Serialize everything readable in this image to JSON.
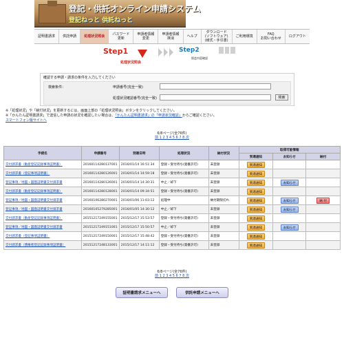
{
  "header": {
    "title": "登記・供託オンライン申請システム",
    "subtitle": "登記ねっと 供託ねっと"
  },
  "nav": [
    {
      "label": "証明書請求"
    },
    {
      "label": "供託申請"
    },
    {
      "label": "処理状況照会",
      "active": true
    },
    {
      "label": "パスワード\n更新"
    },
    {
      "label": "申請者情報\n変更"
    },
    {
      "label": "申請者情報\n抹消"
    },
    {
      "label": "ヘルプ"
    },
    {
      "label": "ダウンロード\n(ソフトウェア)\n(様式・手引書)"
    },
    {
      "label": "ご利用環境"
    },
    {
      "label": "FAQ\nお問い合わせ"
    },
    {
      "label": "ログアウト"
    }
  ],
  "steps": {
    "step1": "Step1",
    "step1_label": "処理状況照会",
    "step2": "Step2",
    "step2_label": "照会内容確認"
  },
  "search": {
    "caption": "確認する申請・請求の条件を入力してください",
    "condition_label": "検索条件：",
    "field1_label": "申請番号(完全一致)",
    "field2_label": "処理状況確認番号(完全一致)",
    "field1_value": "",
    "field2_value": "",
    "button": "検索"
  },
  "notes": {
    "line1": "※「処理状況」や「納付状況」を更新するには、画面上部の「処理状況照会」ボタンをクリックしてください。",
    "line2_pre": "※「かんたん証明書請求」で送信した申請の状況を確認したい場合は、",
    "line2_link1": "「かんたん証明書請求」の「申請状況確認」",
    "line2_post": "からご確認ください。",
    "line3": "スマートフォン版サイトへ"
  },
  "pager": {
    "summary": "6/8ページ(全76件)",
    "links": "前 1 2 3 4 5 6 7 8 次"
  },
  "table": {
    "headers": {
      "name": "手続名",
      "number": "申請番号",
      "date": "到達日時",
      "status": "処理状況",
      "payment": "納付状況",
      "info": "取得可能情報",
      "arrival": "到達通知",
      "notice": "お知らせ",
      "pay": "納付"
    },
    "rows": [
      {
        "name": "交付請求書（動産登記記録事項証明書）",
        "number": "20160114280137001",
        "date": "2016/01/14 16:51:34",
        "status": "登録・受付待ち(発番許可)",
        "payment": "未登録",
        "arrival": "到達通知",
        "notice": "",
        "pay": ""
      },
      {
        "name": "交付請求書（登記事項証明書）",
        "number": "20160114280126001",
        "date": "2016/01/14 14:59:18",
        "status": "登録・受付待ち(発番許可)",
        "payment": "未登録",
        "arrival": "到達通知",
        "notice": "",
        "pay": ""
      },
      {
        "name": "登記事項／地図・図面証明書交付請求書",
        "number": "20160114280126001",
        "date": "2016/01/14 14:30:31",
        "status": "中止／却下",
        "payment": "未登録",
        "arrival": "到達通知",
        "notice": "お知らせ",
        "pay": ""
      },
      {
        "name": "交付請求書（動産登記記録事項証明書）",
        "number": "20160114280128001",
        "date": "2016/01/14 09:34:51",
        "status": "登録・受付待ち(発番許可)",
        "payment": "未登録",
        "arrival": "到達通知",
        "notice": "",
        "pay": ""
      },
      {
        "name": "登記事項／地図・図面証明書交付請求書",
        "number": "20160106280270001",
        "date": "2016/01/06 11:03:12",
        "status": "処理中",
        "payment": "納付期限切れ",
        "arrival": "到達通知",
        "notice": "お知らせ",
        "pay": "納 付"
      },
      {
        "name": "登記事項／地図・図面証明書交付請求書",
        "number": "20160105279285001",
        "date": "2016/01/05 14:30:12",
        "status": "中止／却下",
        "payment": "未登録",
        "arrival": "到達通知",
        "notice": "お知らせ",
        "pay": ""
      },
      {
        "name": "交付請求書（動産登記記録事項証明書）",
        "number": "20151217249155001",
        "date": "2015/12/17 15:53:57",
        "status": "登録・受付待ち(発番許可)",
        "payment": "未登録",
        "arrival": "到達通知",
        "notice": "",
        "pay": ""
      },
      {
        "name": "登記事項／地図・図面証明書交付請求書",
        "number": "20151217249151001",
        "date": "2015/12/17 15:50:57",
        "status": "中止／却下",
        "payment": "未登録",
        "arrival": "到達通知",
        "notice": "お知らせ",
        "pay": ""
      },
      {
        "name": "交付請求書（登記事項証明書）",
        "number": "20151217249150001",
        "date": "2015/12/17 15:48:42",
        "status": "登録・受付待ち(発番許可)",
        "payment": "未登録",
        "arrival": "到達通知",
        "notice": "",
        "pay": ""
      },
      {
        "name": "交付請求書（債権者登記記録事項証明書）",
        "number": "20151217248133001",
        "date": "2015/12/17 14:11:12",
        "status": "登録・受付待ち(発番許可)",
        "payment": "未登録",
        "arrival": "到達通知",
        "notice": "",
        "pay": ""
      }
    ]
  },
  "bottom": {
    "cert_menu": "証明書請求メニューへ",
    "deposit_menu": "供託申請メニューへ"
  }
}
